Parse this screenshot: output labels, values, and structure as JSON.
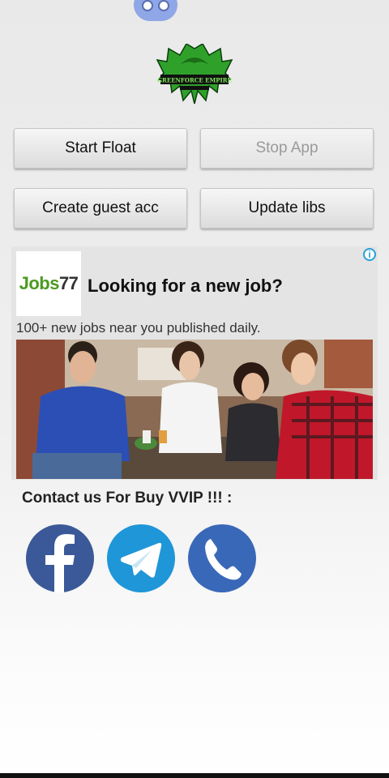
{
  "logo": {
    "name": "Green Force Empire logo",
    "text": "GREENFORCE EMPIRE"
  },
  "buttons": {
    "start_float": "Start Float",
    "stop_app": "Stop App",
    "create_guest": "Create guest acc",
    "update_libs": "Update libs"
  },
  "ad": {
    "brand_prefix": "Jobs",
    "brand_number": "77",
    "headline": "Looking for a new job?",
    "subtext": "100+ new jobs near you published daily.",
    "info_icon": "i"
  },
  "contact": {
    "label": "Contact us For Buy VVIP !!! :",
    "icons": [
      "facebook-icon",
      "telegram-icon",
      "phone-icon"
    ]
  },
  "colors": {
    "facebook": "#3b5998",
    "telegram": "#1f96d8",
    "phone": "#3a68b8",
    "jobs_green": "#4a9a1f"
  }
}
